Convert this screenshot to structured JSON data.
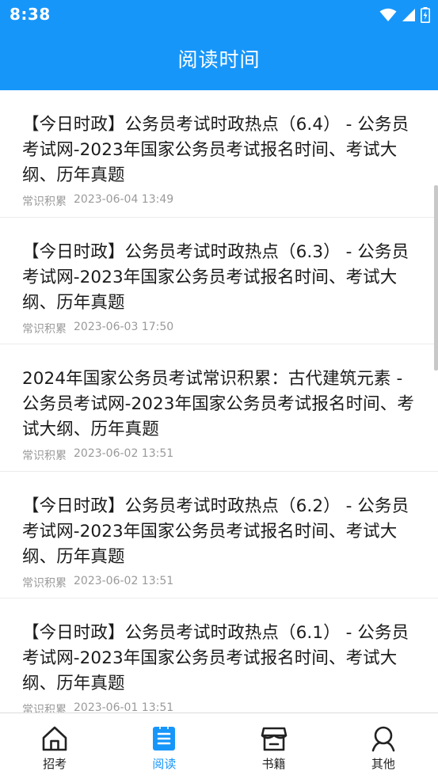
{
  "status_bar": {
    "time": "8:38"
  },
  "header": {
    "title": "阅读时间"
  },
  "colors": {
    "accent": "#1796fa",
    "inactive": "#222222"
  },
  "articles": [
    {
      "title": "【今日时政】公务员考试时政热点（6.4） - 公务员考试网-2023年国家公务员考试报名时间、考试大纲、历年真题",
      "category": "常识积累",
      "date": "2023-06-04 13:49"
    },
    {
      "title": "【今日时政】公务员考试时政热点（6.3） - 公务员考试网-2023年国家公务员考试报名时间、考试大纲、历年真题",
      "category": "常识积累",
      "date": "2023-06-03 17:50"
    },
    {
      "title": "2024年国家公务员考试常识积累：古代建筑元素 - 公务员考试网-2023年国家公务员考试报名时间、考试大纲、历年真题",
      "category": "常识积累",
      "date": "2023-06-02 13:51"
    },
    {
      "title": "【今日时政】公务员考试时政热点（6.2） - 公务员考试网-2023年国家公务员考试报名时间、考试大纲、历年真题",
      "category": "常识积累",
      "date": "2023-06-02 13:51"
    },
    {
      "title": "【今日时政】公务员考试时政热点（6.1） - 公务员考试网-2023年国家公务员考试报名时间、考试大纲、历年真题",
      "category": "常识积累",
      "date": "2023-06-01 13:51"
    }
  ],
  "tabs": [
    {
      "label": "招考",
      "icon": "home-icon",
      "active": false
    },
    {
      "label": "阅读",
      "icon": "reading-icon",
      "active": true
    },
    {
      "label": "书籍",
      "icon": "store-icon",
      "active": false
    },
    {
      "label": "其他",
      "icon": "person-icon",
      "active": false
    }
  ]
}
